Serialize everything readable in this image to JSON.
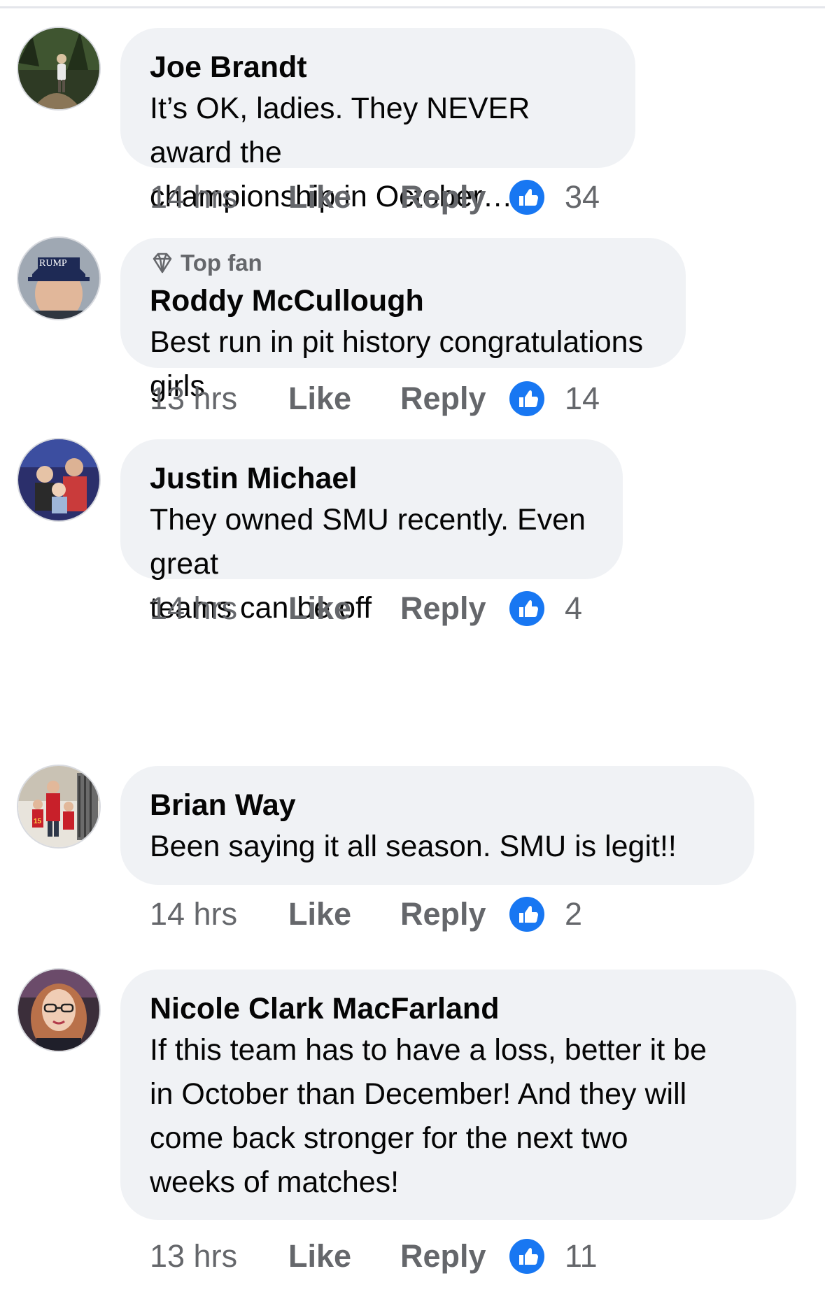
{
  "comments": [
    {
      "author": "Joe Brandt",
      "badge": "",
      "text": "It’s OK, ladies.  They NEVER award the\nchampionship in October…",
      "time": "14 hrs",
      "like_label": "Like",
      "reply_label": "Reply",
      "reaction_icon": "thumbs-up-icon",
      "reaction_count": "34",
      "avatar": "hiker-forest-photo"
    },
    {
      "author": "Roddy McCullough",
      "badge": "Top fan",
      "badge_icon": "diamond-icon",
      "text": "Best run in pit history congratulations girls",
      "time": "13 hrs",
      "like_label": "Like",
      "reply_label": "Reply",
      "reaction_icon": "thumbs-up-icon",
      "reaction_count": "14",
      "avatar": "man-in-cap-photo"
    },
    {
      "author": "Justin Michael",
      "badge": "",
      "text": "They owned SMU recently. Even great\nteams can be off",
      "time": "14 hrs",
      "like_label": "Like",
      "reply_label": "Reply",
      "reaction_icon": "thumbs-up-icon",
      "reaction_count": "4",
      "avatar": "family-photo"
    },
    {
      "author": "Brian Way",
      "badge": "",
      "text": "Been saying it all season. SMU is legit!!",
      "time": "14 hrs",
      "like_label": "Like",
      "reply_label": "Reply",
      "reaction_icon": "thumbs-up-icon",
      "reaction_count": "2",
      "avatar": "family-porch-photo"
    },
    {
      "author": "Nicole Clark MacFarland",
      "badge": "",
      "text": "If this team has to have a loss, better it be\nin October than December!  And they will\ncome back stronger for the next two\nweeks of matches!",
      "time": "13 hrs",
      "like_label": "Like",
      "reply_label": "Reply",
      "reaction_icon": "thumbs-up-icon",
      "reaction_count": "11",
      "avatar": "woman-glasses-photo"
    }
  ],
  "colors": {
    "bubble": "#f0f2f5",
    "meta_text": "#65676b",
    "like_blue": "#1877f2"
  }
}
